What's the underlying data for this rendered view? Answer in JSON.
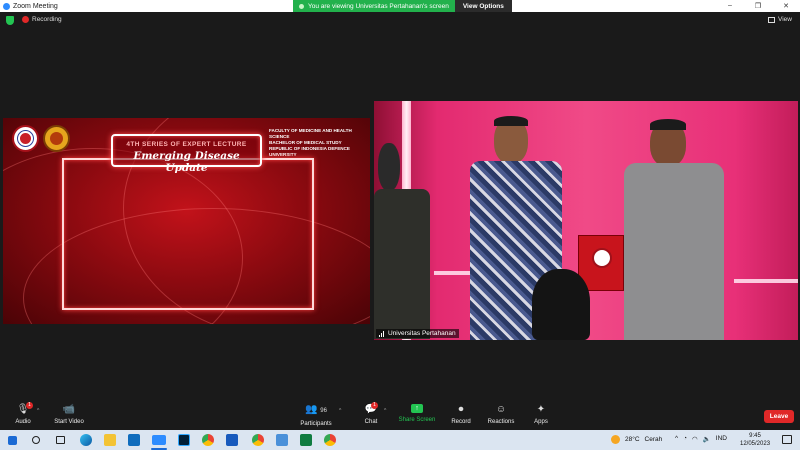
{
  "window": {
    "title": "Zoom Meeting",
    "controls": [
      "–",
      "❐",
      "✕"
    ]
  },
  "share_banner": {
    "message": "You are viewing Universitas Pertahanan's screen",
    "view_options": "View Options"
  },
  "meeting_top": {
    "recording": "Recording",
    "view": "View"
  },
  "slide": {
    "header_line1": "4TH SERIES OF EXPERT LECTURE",
    "header_line2": "Emerging Disease Update",
    "info_line1": "FACULTY OF MEDICINE AND HEALTH SCIENCE",
    "info_line2": "BACHELOR OF MEDICAL STUDY",
    "info_line3": "REPUBLIC OF INDONESIA DEFENCE UNIVERSITY"
  },
  "video": {
    "participant_name": "Universitas Pertahanan"
  },
  "toolbar": {
    "audio": "Audio",
    "start_video": "Start Video",
    "participants": "Participants",
    "participants_count": "96",
    "chat": "Chat",
    "chat_badge": "1",
    "share_screen": "Share Screen",
    "record": "Record",
    "reactions": "Reactions",
    "apps": "Apps",
    "leave": "Leave",
    "audio_badge": "1"
  },
  "taskbar": {
    "weather_temp": "28°C",
    "weather_desc": "Cerah",
    "lang": "IND",
    "time": "9:45",
    "date": "12/05/2023"
  },
  "colors": {
    "accent_green": "#23c552",
    "leave_red": "#e02828",
    "zoom_blue": "#2d8cff"
  }
}
